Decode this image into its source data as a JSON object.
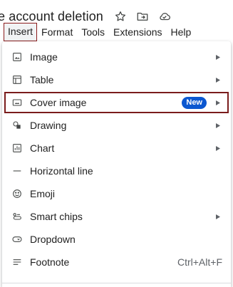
{
  "document": {
    "title": "e account deletion"
  },
  "title_icons": [
    {
      "name": "star-icon"
    },
    {
      "name": "move-folder-icon"
    },
    {
      "name": "cloud-saved-icon"
    }
  ],
  "menubar": {
    "items": [
      {
        "label": "Insert",
        "active": true
      },
      {
        "label": "Format"
      },
      {
        "label": "Tools"
      },
      {
        "label": "Extensions"
      },
      {
        "label": "Help"
      }
    ]
  },
  "insert_menu": {
    "items": [
      {
        "label": "Image",
        "icon": "image-icon",
        "submenu": true
      },
      {
        "label": "Table",
        "icon": "table-icon",
        "submenu": true
      },
      {
        "label": "Cover image",
        "icon": "cover-image-icon",
        "submenu": true,
        "badge": "New",
        "highlighted": true
      },
      {
        "label": "Drawing",
        "icon": "drawing-icon",
        "submenu": true
      },
      {
        "label": "Chart",
        "icon": "chart-icon",
        "submenu": true
      },
      {
        "label": "Horizontal line",
        "icon": "horizontal-line-icon",
        "submenu": false
      },
      {
        "label": "Emoji",
        "icon": "emoji-icon",
        "submenu": false
      },
      {
        "label": "Smart chips",
        "icon": "smart-chips-icon",
        "submenu": true
      },
      {
        "label": "Dropdown",
        "icon": "dropdown-icon",
        "submenu": false
      },
      {
        "label": "Footnote",
        "icon": "footnote-icon",
        "submenu": false,
        "shortcut": "Ctrl+Alt+F"
      }
    ]
  },
  "colors": {
    "accent_blue": "#0b57d0",
    "highlight_outline": "#7a1c1c",
    "text": "#1f1f1f",
    "muted": "#5f6368"
  }
}
